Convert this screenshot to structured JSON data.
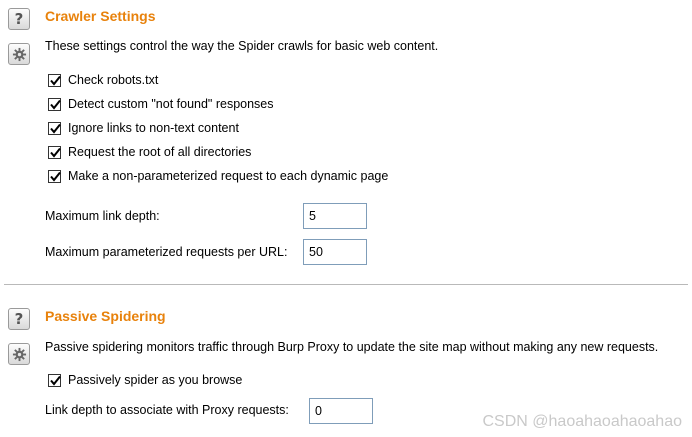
{
  "crawler": {
    "title": "Crawler Settings",
    "description": "These settings control the way the Spider crawls for basic web content.",
    "options": [
      {
        "label": "Check robots.txt",
        "checked": true
      },
      {
        "label": "Detect custom \"not found\" responses",
        "checked": true
      },
      {
        "label": "Ignore links to non-text content",
        "checked": true
      },
      {
        "label": "Request the root of all directories",
        "checked": true
      },
      {
        "label": "Make a non-parameterized request to each dynamic page",
        "checked": true
      }
    ],
    "max_link_depth_label": "Maximum link depth:",
    "max_link_depth_value": "5",
    "max_param_requests_label": "Maximum parameterized requests per URL:",
    "max_param_requests_value": "50"
  },
  "passive": {
    "title": "Passive Spidering",
    "description": "Passive spidering monitors traffic through Burp Proxy to update the site map without making any new requests.",
    "options": [
      {
        "label": "Passively spider as you browse",
        "checked": true
      }
    ],
    "link_depth_label": "Link depth to associate with Proxy requests:",
    "link_depth_value": "0"
  },
  "icons": {
    "help": "question-icon",
    "settings": "gear-icon"
  },
  "watermark": "CSDN @haoahaoahaoahao"
}
